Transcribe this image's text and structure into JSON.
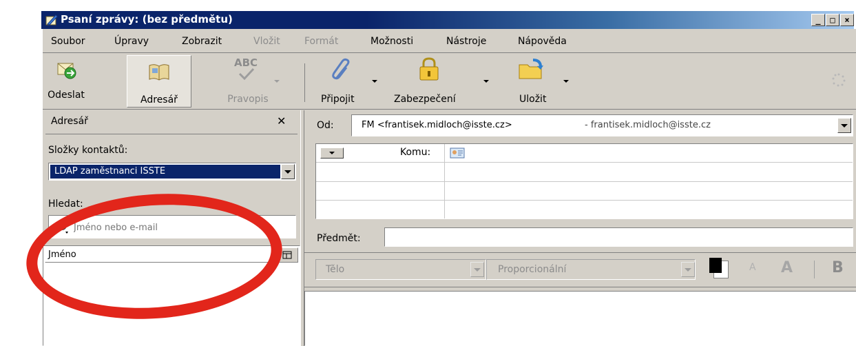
{
  "window": {
    "title": "Psaní zprávy: (bez předmětu)",
    "controls": [
      "_",
      "□",
      "×"
    ]
  },
  "menu": [
    {
      "label": "Soubor",
      "enabled": true
    },
    {
      "label": "Úpravy",
      "enabled": true
    },
    {
      "label": "Zobrazit",
      "enabled": true
    },
    {
      "label": "Vložit",
      "enabled": false
    },
    {
      "label": "Formát",
      "enabled": false
    },
    {
      "label": "Možnosti",
      "enabled": true
    },
    {
      "label": "Nástroje",
      "enabled": true
    },
    {
      "label": "Nápověda",
      "enabled": true
    }
  ],
  "toolbar": {
    "send": "Odeslat",
    "address_book": "Adresář",
    "spelling": "Pravopis",
    "spelling_icon_text": "ABC",
    "attach": "Připojit",
    "security": "Zabezpečení",
    "save": "Uložit"
  },
  "sidebar": {
    "title": "Adresář",
    "close": "✕",
    "folders_label": "Složky kontaktů:",
    "folder_selected": "LDAP zaměstnanci ISSTE",
    "search_label": "Hledat:",
    "search_placeholder": "Jméno nebo e-mail",
    "column_name": "Jméno"
  },
  "compose": {
    "from_label": "Od:",
    "from_value": "FM <frantisek.midloch@isste.cz>",
    "from_account": "- frantisek.midloch@isste.cz",
    "to_label": "Komu:",
    "subject_label": "Předmět:",
    "subject_value": "",
    "format_style": "Tělo",
    "format_font": "Proporcionální",
    "bold_label": "B",
    "font_smaller": "A",
    "font_larger": "A"
  },
  "colors": {
    "titlebar": "#0a246a",
    "highlight": "#0a246a",
    "annotation_ellipse": "#e2261b",
    "chrome": "#d4d0c8"
  }
}
